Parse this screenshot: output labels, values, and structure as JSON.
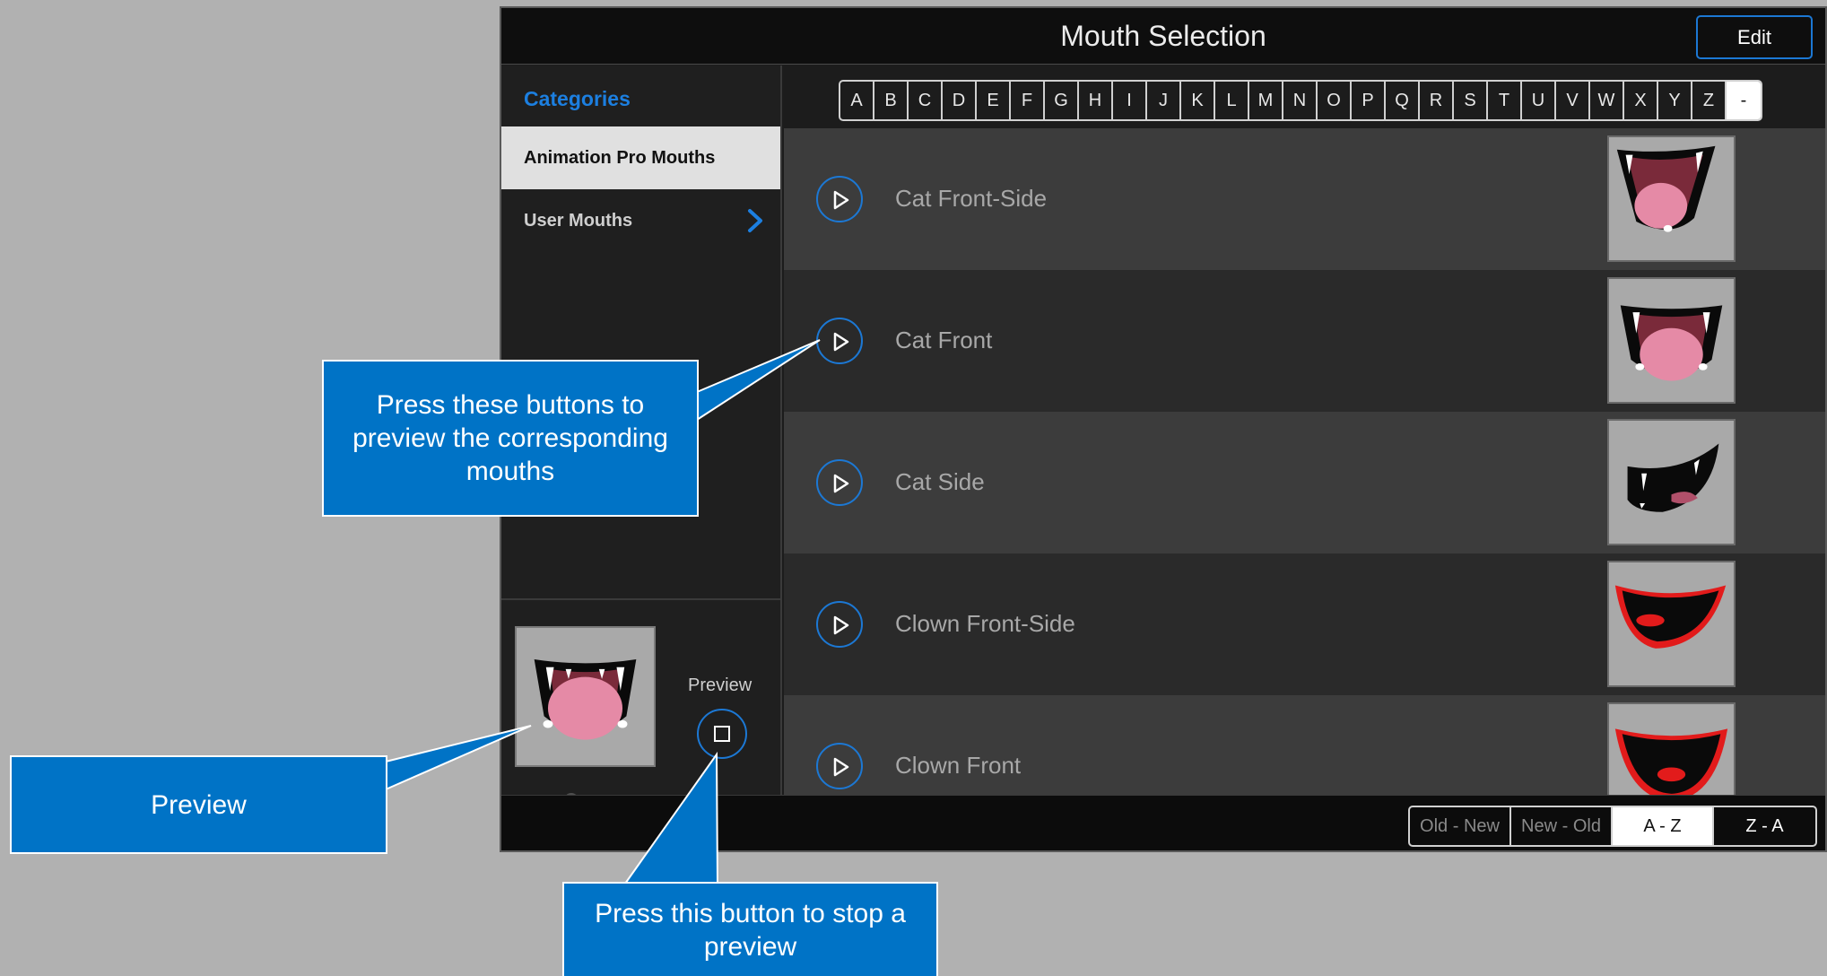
{
  "window": {
    "title": "Mouth Selection",
    "edit_label": "Edit"
  },
  "sidebar": {
    "categories_label": "Categories",
    "items": [
      {
        "label": "Animation Pro Mouths",
        "selected": true
      },
      {
        "label": "User Mouths",
        "has_chevron": true
      }
    ],
    "preview_label": "Preview",
    "stop_icon": "stop-square-icon",
    "search_icon": "search-icon"
  },
  "alphabet": [
    "A",
    "B",
    "C",
    "D",
    "E",
    "F",
    "G",
    "H",
    "I",
    "J",
    "K",
    "L",
    "M",
    "N",
    "O",
    "P",
    "Q",
    "R",
    "S",
    "T",
    "U",
    "V",
    "W",
    "X",
    "Y",
    "Z",
    "-"
  ],
  "mouths": [
    {
      "name": "Cat Front-Side",
      "thumb": "cat-front-side"
    },
    {
      "name": "Cat Front",
      "thumb": "cat-front"
    },
    {
      "name": "Cat Side",
      "thumb": "cat-side"
    },
    {
      "name": "Clown Front-Side",
      "thumb": "clown-front-side"
    },
    {
      "name": "Clown Front",
      "thumb": "clown-front"
    }
  ],
  "sort": {
    "options": [
      "Old - New",
      "New - Old",
      "A - Z",
      "Z - A"
    ],
    "selected": "A - Z"
  },
  "callouts": {
    "play": "Press these buttons to preview the corresponding mouths",
    "preview": "Preview",
    "stop": "Press this button to stop a preview"
  },
  "colors": {
    "accent": "#1c78d4",
    "callout": "#0073c6"
  }
}
